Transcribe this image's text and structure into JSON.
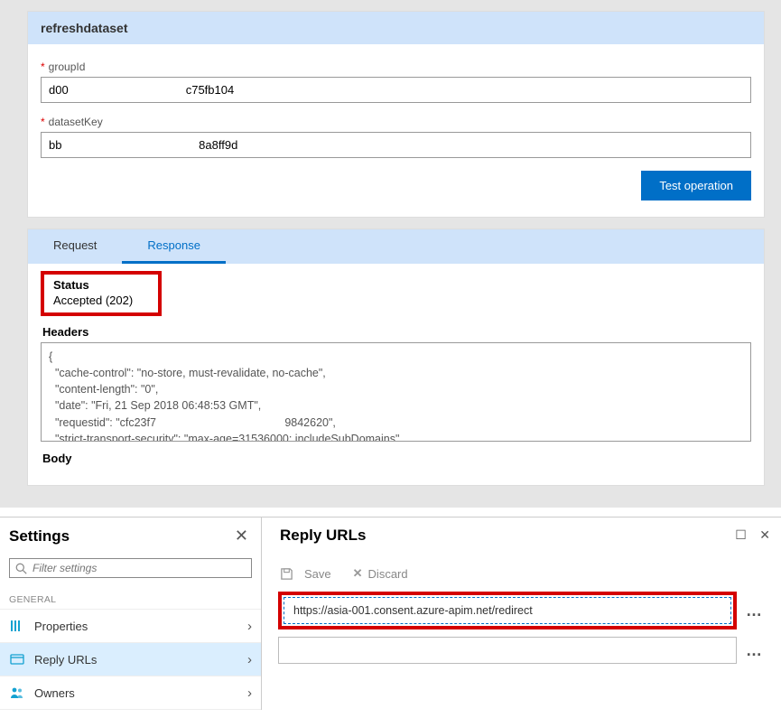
{
  "api": {
    "title": "refreshdataset",
    "fields": {
      "groupId": {
        "label": "groupId",
        "value": "d00                                    c75fb104"
      },
      "datasetKey": {
        "label": "datasetKey",
        "value": "bb                                          8a8ff9d"
      }
    },
    "test_btn": "Test operation",
    "tabs": {
      "request": "Request",
      "response": "Response"
    },
    "status_label": "Status",
    "status_value": "Accepted (202)",
    "headers_label": "Headers",
    "headers_text": "{\n  \"cache-control\": \"no-store, must-revalidate, no-cache\",\n  \"content-length\": \"0\",\n  \"date\": \"Fri, 21 Sep 2018 06:48:53 GMT\",\n  \"requestid\": \"cfc23f7                                         9842620\",\n  \"strict-transport-security\": \"max-age=31536000; includeSubDomains\",",
    "body_label": "Body"
  },
  "settings": {
    "title": "Settings",
    "search_placeholder": "Filter settings",
    "group": "GENERAL",
    "items": {
      "properties": "Properties",
      "reply_urls": "Reply URLs",
      "owners": "Owners"
    }
  },
  "reply": {
    "title": "Reply URLs",
    "save": "Save",
    "discard": "Discard",
    "url1": "https://asia-001.consent.azure-apim.net/redirect",
    "url2": ""
  }
}
